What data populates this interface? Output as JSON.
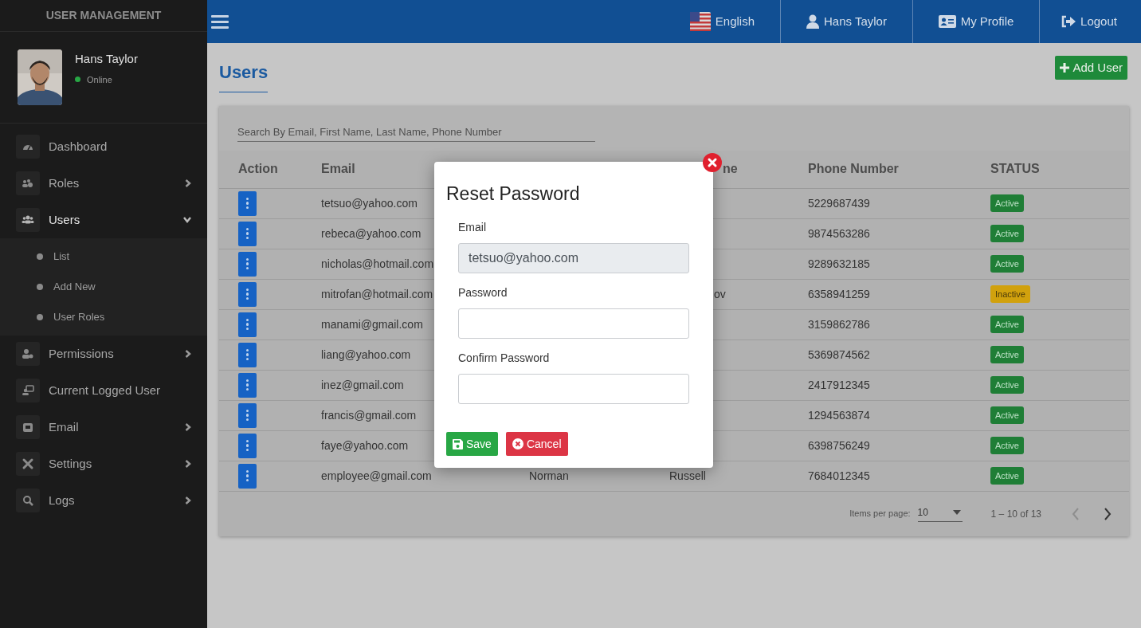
{
  "sidebar": {
    "title": "USER MANAGEMENT",
    "profile": {
      "name": "Hans Taylor",
      "status": "Online",
      "online": true
    },
    "items": [
      {
        "label": "Dashboard",
        "expanded": false,
        "has_children": false
      },
      {
        "label": "Roles",
        "expanded": false,
        "has_children": true
      },
      {
        "label": "Users",
        "expanded": true,
        "has_children": true,
        "children": [
          {
            "label": "List"
          },
          {
            "label": "Add New"
          },
          {
            "label": "User Roles"
          }
        ]
      },
      {
        "label": "Permissions",
        "expanded": false,
        "has_children": true
      },
      {
        "label": "Current Logged User",
        "expanded": false,
        "has_children": false
      },
      {
        "label": "Email",
        "expanded": false,
        "has_children": true
      },
      {
        "label": "Settings",
        "expanded": false,
        "has_children": true
      },
      {
        "label": "Logs",
        "expanded": false,
        "has_children": true
      }
    ]
  },
  "topbar": {
    "items": [
      {
        "kind": "language",
        "label": "English"
      },
      {
        "kind": "user",
        "label": "Hans Taylor"
      },
      {
        "kind": "profile",
        "label": "My Profile"
      },
      {
        "kind": "logout",
        "label": "Logout"
      }
    ]
  },
  "page": {
    "title": "Users",
    "add_button": "Add User"
  },
  "search": {
    "placeholder": "Search By Email, First Name, Last Name, Phone Number"
  },
  "table": {
    "columns": [
      {
        "label": "Action"
      },
      {
        "label": "Email"
      },
      {},
      {
        "label": "ne",
        "cut": true
      },
      {
        "label": "Phone Number"
      },
      {
        "label": "STATUS"
      }
    ],
    "rows": [
      {
        "email": "tetsuo@yahoo.com",
        "phone": "5229687439",
        "status": "Active",
        "active": true
      },
      {
        "email": "rebeca@yahoo.com",
        "phone": "9874563286",
        "status": "Active",
        "active": true
      },
      {
        "email": "nicholas@hotmail.com",
        "phone": "9289632185",
        "status": "Active",
        "active": true
      },
      {
        "email": "mitrofan@hotmail.com",
        "last_name": "ov",
        "last_cut": true,
        "phone": "6358941259",
        "status": "Inactive",
        "active": false
      },
      {
        "email": "manami@gmail.com",
        "phone": "3159862786",
        "status": "Active",
        "active": true
      },
      {
        "email": "liang@yahoo.com",
        "phone": "5369874562",
        "status": "Active",
        "active": true
      },
      {
        "email": "inez@gmail.com",
        "phone": "2417912345",
        "status": "Active",
        "active": true
      },
      {
        "email": "francis@gmail.com",
        "phone": "1294563874",
        "status": "Active",
        "active": true
      },
      {
        "email": "faye@yahoo.com",
        "phone": "6398756249",
        "status": "Active",
        "active": true
      },
      {
        "email": "employee@gmail.com",
        "first_name": "Norman",
        "last_name": "Russell",
        "phone": "7684012345",
        "status": "Active",
        "active": true
      }
    ]
  },
  "paginator": {
    "label": "Items per page:",
    "page_size": "10",
    "range": "1 – 10 of 13",
    "prev_disabled": true,
    "next_disabled": false
  },
  "dialog": {
    "title": "Reset Password",
    "fields": [
      {
        "label": "Email",
        "value": "tetsuo@yahoo.com",
        "disabled": true
      },
      {
        "label": "Password",
        "disabled": false
      },
      {
        "label": "Confirm Password",
        "disabled": false
      }
    ],
    "save": "Save",
    "cancel": "Cancel"
  }
}
